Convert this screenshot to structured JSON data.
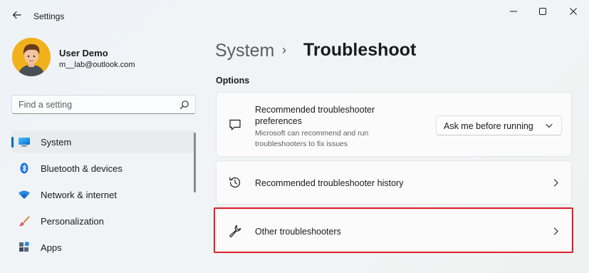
{
  "window": {
    "title": "Settings",
    "controls": {
      "minimize": "minimize-icon",
      "maximize": "maximize-icon",
      "close": "close-icon"
    }
  },
  "profile": {
    "name": "User Demo",
    "email": "m__lab@outlook.com"
  },
  "search": {
    "placeholder": "Find a setting",
    "icon": "search-icon"
  },
  "sidebar": {
    "items": [
      {
        "label": "System",
        "icon": "monitor-icon",
        "active": true
      },
      {
        "label": "Bluetooth & devices",
        "icon": "bluetooth-icon",
        "active": false
      },
      {
        "label": "Network & internet",
        "icon": "wifi-icon",
        "active": false
      },
      {
        "label": "Personalization",
        "icon": "brush-icon",
        "active": false
      },
      {
        "label": "Apps",
        "icon": "apps-icon",
        "active": false
      }
    ]
  },
  "breadcrumb": {
    "root": "System",
    "separator": "›",
    "current": "Troubleshoot"
  },
  "section": {
    "title": "Options"
  },
  "cards": {
    "preferences": {
      "title": "Recommended troubleshooter preferences",
      "description": "Microsoft can recommend and run troubleshooters to fix issues",
      "icon": "feedback-icon",
      "dropdown_value": "Ask me before running"
    },
    "history": {
      "label": "Recommended troubleshooter history",
      "icon": "history-icon"
    },
    "other": {
      "label": "Other troubleshooters",
      "icon": "wrench-icon",
      "highlighted": true
    }
  },
  "colors": {
    "accent": "#0067c0",
    "highlight": "#e01f2d",
    "avatar_bg": "#f1b11b"
  }
}
